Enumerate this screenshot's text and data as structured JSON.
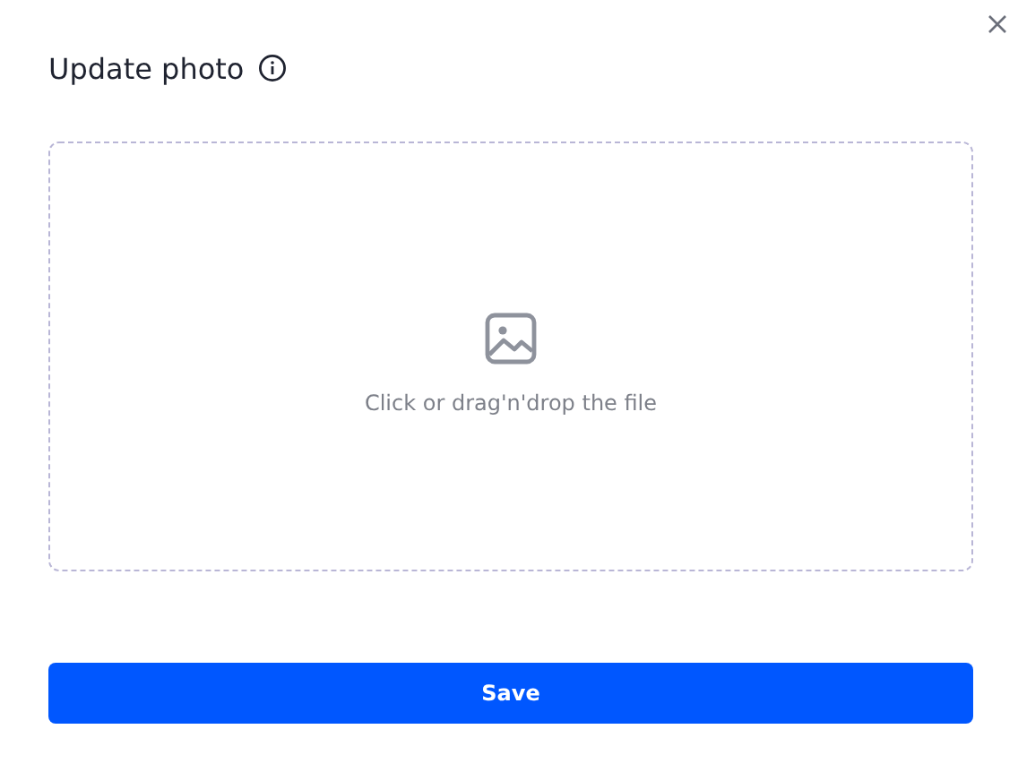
{
  "dialog": {
    "title": "Update photo"
  },
  "dropzone": {
    "hint": "Click or drag'n'drop the file"
  },
  "buttons": [
    {
      "label": "Save",
      "kind": "primary"
    }
  ]
}
